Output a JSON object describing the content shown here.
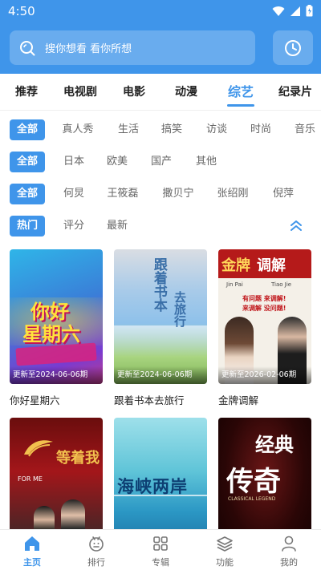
{
  "status": {
    "time": "4:50"
  },
  "search": {
    "placeholder": "搜你想看 看你所想"
  },
  "tabs": [
    {
      "label": "推荐"
    },
    {
      "label": "电视剧"
    },
    {
      "label": "电影"
    },
    {
      "label": "动漫"
    },
    {
      "label": "综艺",
      "active": true
    },
    {
      "label": "纪录片"
    }
  ],
  "filters": {
    "type": [
      "全部",
      "真人秀",
      "生活",
      "搞笑",
      "访谈",
      "时尚",
      "音乐"
    ],
    "region": [
      "全部",
      "日本",
      "欧美",
      "国产",
      "其他"
    ],
    "people": [
      "全部",
      "何炅",
      "王筱磊",
      "撒贝宁",
      "张绍刚",
      "倪萍"
    ],
    "sort": [
      "热门",
      "评分",
      "最新"
    ]
  },
  "cards": [
    {
      "title": "你好星期六",
      "update": "更新至2024-06-06期",
      "poster_text": [
        "你好",
        "星期六"
      ]
    },
    {
      "title": "跟着书本去旅行",
      "update": "更新至2024-06-06期",
      "poster_text": [
        "跟着书本",
        "去旅行"
      ]
    },
    {
      "title": "金牌调解",
      "update": "更新至2026-02-06期",
      "poster_text": [
        "金牌",
        "调解",
        "Jin Pai",
        "Tiao Jie",
        "有问题 来调解!",
        "来调解 没问题!"
      ]
    },
    {
      "title": "",
      "update": "",
      "poster_text": [
        "等着我",
        "FOR ME"
      ]
    },
    {
      "title": "",
      "update": "",
      "poster_text": [
        "海峡两岸"
      ]
    },
    {
      "title": "",
      "update": "",
      "poster_text": [
        "经典",
        "传奇",
        "CLASSICAL LEGEND"
      ]
    }
  ],
  "nav": [
    {
      "label": "主页",
      "icon": "home-icon",
      "active": true
    },
    {
      "label": "排行",
      "icon": "rank-icon"
    },
    {
      "label": "专辑",
      "icon": "album-icon"
    },
    {
      "label": "功能",
      "icon": "layers-icon"
    },
    {
      "label": "我的",
      "icon": "user-icon"
    }
  ],
  "colors": {
    "accent": "#3f95ea",
    "header": "#3f95ea"
  }
}
